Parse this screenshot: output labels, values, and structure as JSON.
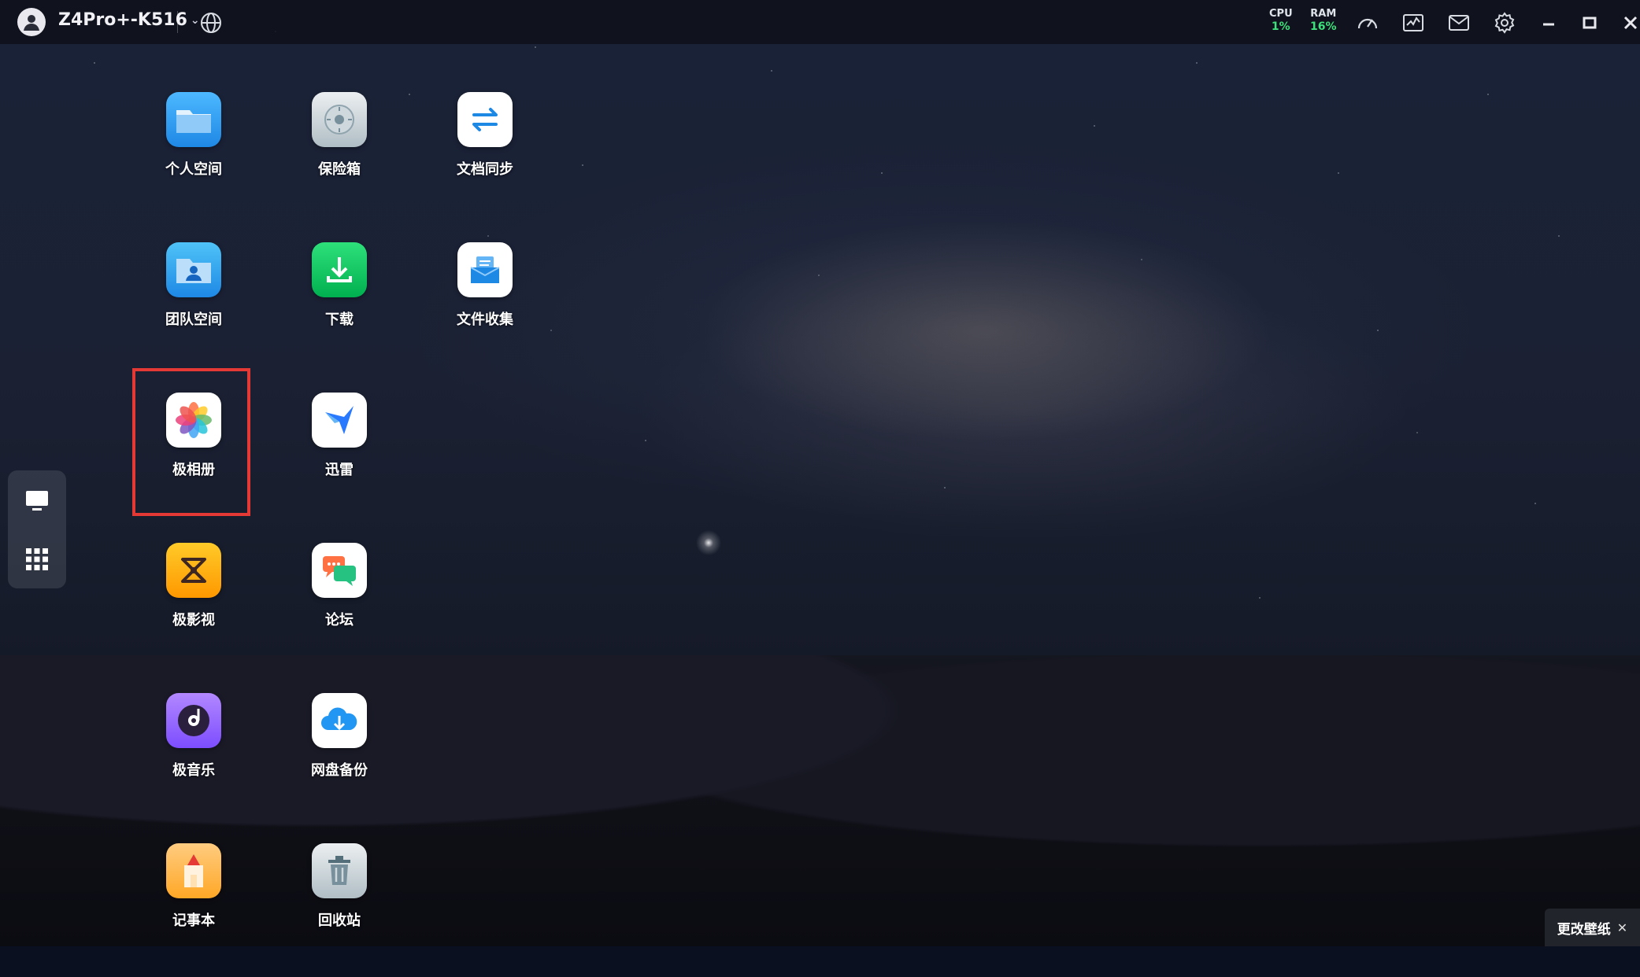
{
  "topbar": {
    "device_name": "Z4Pro+-K516",
    "cpu_label": "CPU",
    "cpu_value": "1%",
    "ram_label": "RAM",
    "ram_value": "16%"
  },
  "apps": {
    "personal_space": "个人空间",
    "safe_box": "保险箱",
    "doc_sync": "文档同步",
    "team_space": "团队空间",
    "download": "下载",
    "file_collect": "文件收集",
    "album": "极相册",
    "xunlei": "迅雷",
    "video": "极影视",
    "forum": "论坛",
    "music": "极音乐",
    "cloud_backup": "网盘备份",
    "notepad": "记事本",
    "recycle_bin": "回收站"
  },
  "wallpaper_button": {
    "label": "更改壁纸"
  },
  "colors": {
    "highlight": "#e53935",
    "stat_value": "#3de07a"
  }
}
